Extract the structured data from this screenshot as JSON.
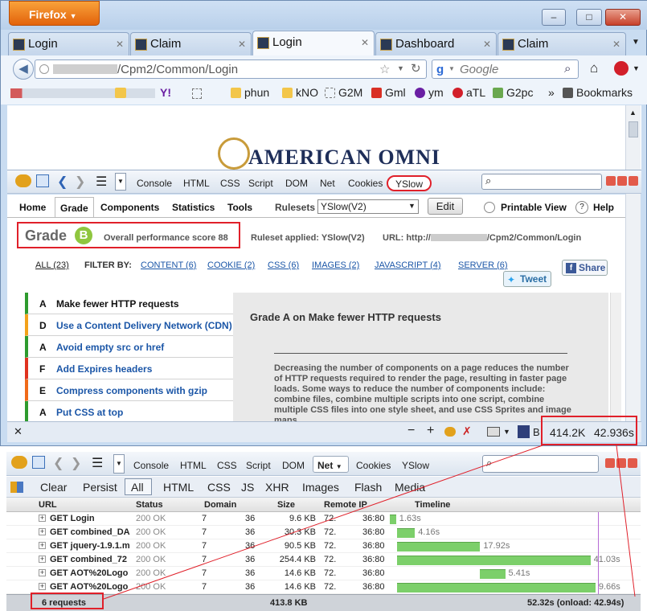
{
  "browser": {
    "app_button": "Firefox",
    "window_controls": [
      "–",
      "□",
      "✕"
    ],
    "tabs": [
      {
        "label": "Login",
        "active": false
      },
      {
        "label": "Claim",
        "active": false
      },
      {
        "label": "Login",
        "active": true
      },
      {
        "label": "Dashboard",
        "active": false
      },
      {
        "label": "Claim",
        "active": false
      }
    ],
    "url_visible": "/Cpm2/Common/Login",
    "search_placeholder": "Google",
    "bookmarks": [
      "phun",
      "kNO",
      "G2M",
      "Gml",
      "ym",
      "aTL",
      "G2pc"
    ],
    "bookmarks_label": "Bookmarks",
    "page_logo_text": "AMERICAN OMNI"
  },
  "firebug_top": {
    "tabs": [
      "Console",
      "HTML",
      "CSS",
      "Script",
      "DOM",
      "Net",
      "Cookies",
      "YSlow"
    ],
    "active": "YSlow"
  },
  "yslow": {
    "nav": [
      "Home",
      "Grade",
      "Components",
      "Statistics",
      "Tools"
    ],
    "rulesets_label": "Rulesets",
    "ruleset_value": "YSlow(V2)",
    "edit_label": "Edit",
    "printable_view": "Printable View",
    "help": "Help",
    "grade_label": "Grade",
    "grade_letter": "B",
    "overall_score": "Overall performance score 88",
    "ruleset_applied": "Ruleset applied: YSlow(V2)",
    "url_label": "URL: http://",
    "url_tail": "/Cpm2/Common/Login",
    "filter": {
      "all": "ALL (23)",
      "filter_by": "FILTER BY:",
      "items": [
        "CONTENT (6)",
        "COOKIE (2)",
        "CSS (6)",
        "IMAGES (2)",
        "JAVASCRIPT (4)",
        "SERVER (6)"
      ]
    },
    "share": "Share",
    "tweet": "Tweet",
    "rules": [
      {
        "grade": "A",
        "text": "Make fewer HTTP requests",
        "color": "#2e9b2e"
      },
      {
        "grade": "D",
        "text": "Use a Content Delivery Network (CDN)",
        "color": "#f3a21a"
      },
      {
        "grade": "A",
        "text": "Avoid empty src or href",
        "color": "#2e9b2e"
      },
      {
        "grade": "F",
        "text": "Add Expires headers",
        "color": "#e0321f"
      },
      {
        "grade": "E",
        "text": "Compress components with gzip",
        "color": "#f06a1a"
      },
      {
        "grade": "A",
        "text": "Put CSS at top",
        "color": "#2e9b2e"
      }
    ],
    "detail_title": "Grade A on Make fewer HTTP requests",
    "detail_body": "Decreasing the number of components on a page reduces the number of HTTP requests required to render the page, resulting in faster page loads. Some ways to reduce the number of components include: combine files, combine multiple scripts into one script, combine multiple CSS files into one style sheet, and use CSS Sprites and image maps."
  },
  "statusbar": {
    "size": "414.2K",
    "time": "42.936s"
  },
  "firebug_bottom": {
    "tabs": [
      "Console",
      "HTML",
      "CSS",
      "Script",
      "DOM",
      "Net",
      "Cookies",
      "YSlow"
    ],
    "active": "Net",
    "net_filters": [
      "Clear",
      "Persist",
      "All",
      "HTML",
      "CSS",
      "JS",
      "XHR",
      "Images",
      "Flash",
      "Media"
    ],
    "columns": [
      "URL",
      "Status",
      "Domain",
      "Size",
      "Remote IP",
      "Timeline"
    ],
    "rows": [
      {
        "url": "GET Login",
        "status": "200 OK",
        "d1": "7",
        "d2": "36",
        "size": "9.6 KB",
        "ip": "72.",
        "port": "36:80",
        "time": "1.63s",
        "start": 0.0,
        "dur": 0.025
      },
      {
        "url": "GET combined_DA",
        "status": "200 OK",
        "d1": "7",
        "d2": "36",
        "size": "30.3 KB",
        "ip": "72.",
        "port": "36:80",
        "time": "4.16s",
        "start": 0.03,
        "dur": 0.07
      },
      {
        "url": "GET jquery-1.9.1.m",
        "status": "200 OK",
        "d1": "7",
        "d2": "36",
        "size": "90.5 KB",
        "ip": "72.",
        "port": "36:80",
        "time": "17.92s",
        "start": 0.03,
        "dur": 0.33
      },
      {
        "url": "GET combined_72",
        "status": "200 OK",
        "d1": "7",
        "d2": "36",
        "size": "254.4 KB",
        "ip": "72.",
        "port": "36:80",
        "time": "41.03s",
        "start": 0.03,
        "dur": 0.77
      },
      {
        "url": "GET AOT%20Logo",
        "status": "200 OK",
        "d1": "7",
        "d2": "36",
        "size": "14.6 KB",
        "ip": "72.",
        "port": "36:80",
        "time": "5.41s",
        "start": 0.36,
        "dur": 0.1
      },
      {
        "url": "GET AOT%20Logo",
        "status": "200 OK",
        "d1": "7",
        "d2": "36",
        "size": "14.6 KB",
        "ip": "72.",
        "port": "36:80",
        "time": "9.66s",
        "start": 0.03,
        "dur": 0.79
      }
    ],
    "footer_requests": "6 requests",
    "footer_size": "413.8 KB",
    "footer_time": "52.32s (onload: 42.94s)"
  }
}
